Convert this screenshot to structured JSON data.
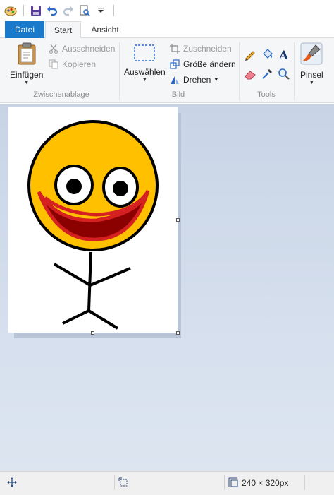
{
  "quick_access": {
    "items": [
      "paint-app-icon",
      "save-icon",
      "undo-icon",
      "redo-icon",
      "print-preview-icon",
      "customize-dropdown-icon"
    ]
  },
  "tabs": {
    "file": "Datei",
    "start": "Start",
    "view": "Ansicht"
  },
  "ribbon": {
    "clipboard": {
      "paste_label": "Einfügen",
      "cut_label": "Ausschneiden",
      "copy_label": "Kopieren",
      "group_label": "Zwischenablage"
    },
    "image": {
      "select_label": "Auswählen",
      "crop_label": "Zuschneiden",
      "resize_label": "Größe ändern",
      "rotate_label": "Drehen",
      "group_label": "Bild"
    },
    "tools": {
      "group_label": "Tools",
      "items": [
        "pencil-icon",
        "fill-bucket-icon",
        "text-icon",
        "eraser-icon",
        "color-picker-icon",
        "magnifier-icon"
      ]
    },
    "brushes": {
      "label": "Pinsel"
    }
  },
  "canvas": {
    "drawing": "smiley-stick-figure"
  },
  "status_bar": {
    "image_size": "240 × 320px"
  },
  "colors": {
    "file_tab": "#1979ca",
    "face_yellow": "#ffc000",
    "mouth_red": "#d42020",
    "mouth_dark": "#8b0000"
  }
}
